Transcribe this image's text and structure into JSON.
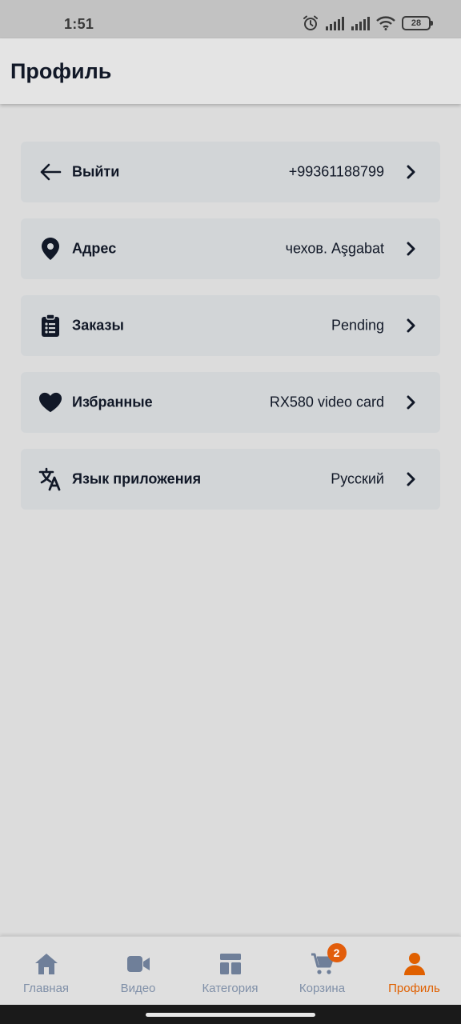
{
  "status_bar": {
    "time": "1:51",
    "battery": "28",
    "icons": [
      "alarm-icon",
      "signal-icon",
      "signal-icon",
      "wifi-icon",
      "battery-icon"
    ]
  },
  "app_bar": {
    "title": "Профиль"
  },
  "menu": [
    {
      "icon": "arrow-left-icon",
      "label": "Выйти",
      "value": "+99361188799"
    },
    {
      "icon": "location-pin-icon",
      "label": "Адрес",
      "value": "чехов. Aşgabat"
    },
    {
      "icon": "clipboard-list-icon",
      "label": "Заказы",
      "value": "Pending"
    },
    {
      "icon": "heart-icon",
      "label": "Избранные",
      "value": "RX580 video card"
    },
    {
      "icon": "translate-icon",
      "label": "Язык приложения",
      "value": "Русский"
    }
  ],
  "bottom_nav": {
    "items": [
      {
        "icon": "home-icon",
        "label": "Главная",
        "active": false
      },
      {
        "icon": "video-icon",
        "label": "Видео",
        "active": false
      },
      {
        "icon": "category-icon",
        "label": "Категория",
        "active": false
      },
      {
        "icon": "cart-icon",
        "label": "Корзина",
        "active": false,
        "badge": "2"
      },
      {
        "icon": "profile-icon",
        "label": "Профиль",
        "active": true
      }
    ]
  },
  "colors": {
    "accent": "#e06000",
    "nav_inactive": "#8090a8",
    "card_background": "#d2d5d7",
    "page_background": "#dcdcdc",
    "text_primary": "#111827"
  }
}
